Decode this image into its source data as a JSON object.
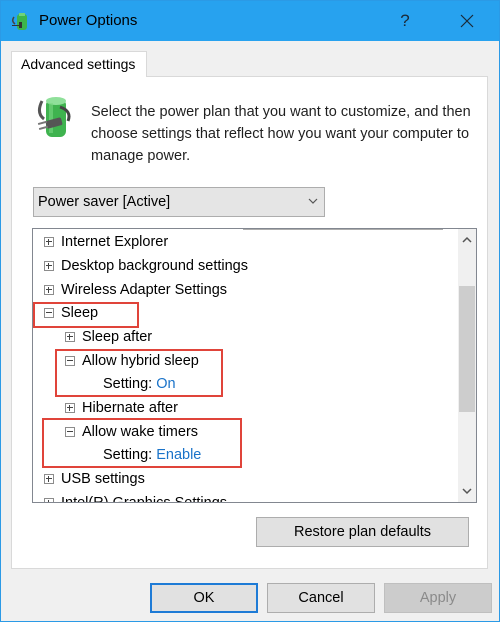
{
  "window": {
    "title": "Power Options",
    "help_label": "?",
    "close_icon": "close-icon",
    "app_icon": "power-options-icon"
  },
  "tab": {
    "label": "Advanced settings"
  },
  "intro": {
    "icon": "battery-plug-icon",
    "text": "Select the power plan that you want to customize, and then choose settings that reflect how you want your computer to manage power."
  },
  "plan_select": {
    "value": "Power saver [Active]"
  },
  "tree": {
    "items": [
      {
        "label": "Internet Explorer",
        "expanded": false,
        "level": 0
      },
      {
        "label": "Desktop background settings",
        "expanded": false,
        "level": 0
      },
      {
        "label": "Wireless Adapter Settings",
        "expanded": false,
        "level": 0
      },
      {
        "label": "Sleep",
        "expanded": true,
        "level": 0
      },
      {
        "label": "Sleep after",
        "expanded": false,
        "level": 1
      },
      {
        "label": "Allow hybrid sleep",
        "expanded": true,
        "level": 1
      },
      {
        "label": "Hibernate after",
        "expanded": false,
        "level": 1
      },
      {
        "label": "Allow wake timers",
        "expanded": true,
        "level": 1
      },
      {
        "label": "USB settings",
        "expanded": false,
        "level": 0
      },
      {
        "label": "Intel(R) Graphics Settings",
        "expanded": false,
        "level": 0
      }
    ],
    "settings": [
      {
        "label": "Setting:",
        "value": "On"
      },
      {
        "label": "Setting:",
        "value": "Enable"
      }
    ]
  },
  "buttons": {
    "restore": "Restore plan defaults",
    "ok": "OK",
    "cancel": "Cancel",
    "apply": "Apply"
  },
  "colors": {
    "titlebar": "#27a2ef",
    "highlight": "#e0443a",
    "link": "#1a73c9"
  }
}
